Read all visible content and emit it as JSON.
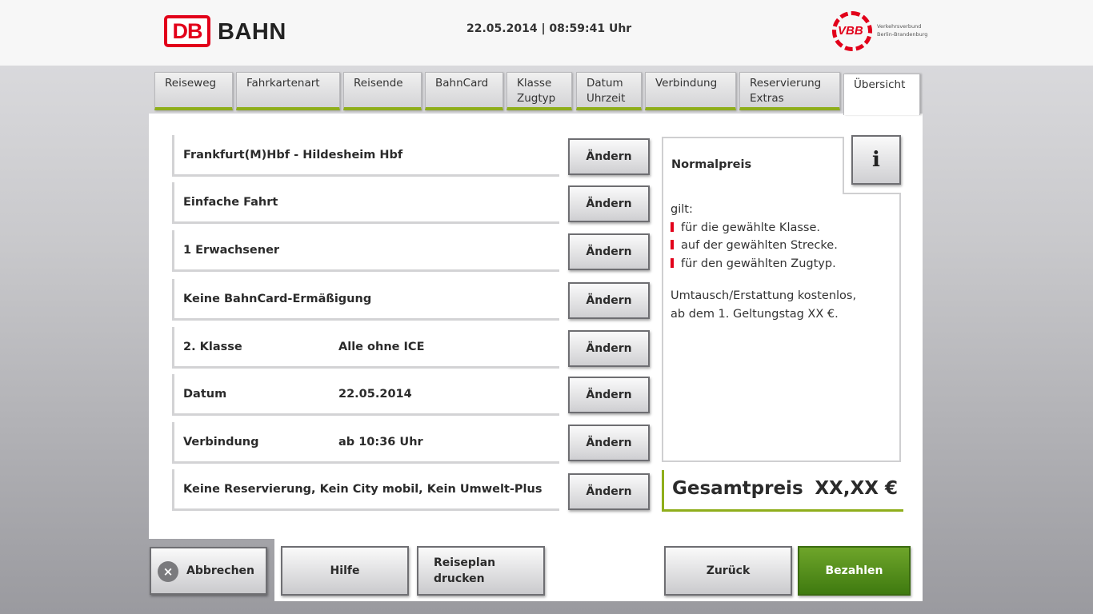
{
  "header": {
    "db_logo": "DB",
    "brand": "BAHN",
    "datetime": "22.05.2014 | 08:59:41 Uhr",
    "vbb_logo": "VBB",
    "vbb_line1": "Verkehrsverbund",
    "vbb_line2": "Berlin-Brandenburg"
  },
  "tabs": [
    {
      "line1": "Reiseweg",
      "line2": ""
    },
    {
      "line1": "Fahrkartenart",
      "line2": ""
    },
    {
      "line1": "Reisende",
      "line2": ""
    },
    {
      "line1": "BahnCard",
      "line2": ""
    },
    {
      "line1": "Klasse",
      "line2": "Zugtyp"
    },
    {
      "line1": "Datum",
      "line2": "Uhrzeit"
    },
    {
      "line1": "Verbindung",
      "line2": ""
    },
    {
      "line1": "Reservierung",
      "line2": "Extras"
    },
    {
      "line1": "Übersicht",
      "line2": ""
    }
  ],
  "rows": [
    {
      "label": "Frankfurt(M)Hbf - Hildesheim Hbf",
      "value": ""
    },
    {
      "label": "Einfache Fahrt",
      "value": ""
    },
    {
      "label": "1 Erwachsener",
      "value": ""
    },
    {
      "label": "Keine BahnCard-Ermäßigung",
      "value": ""
    },
    {
      "label": "2. Klasse",
      "value": "Alle ohne ICE"
    },
    {
      "label": "Datum",
      "value": "22.05.2014"
    },
    {
      "label": "Verbindung",
      "value": "ab 10:36 Uhr"
    },
    {
      "label": "Keine Reservierung, Kein City mobil, Kein Umwelt-Plus",
      "value": ""
    }
  ],
  "change_label": "Ändern",
  "info": {
    "title": "Normalpreis",
    "button": "i",
    "intro": "gilt:",
    "bullets": [
      "für die gewählte Klasse.",
      "auf der gewählten Strecke.",
      "für den gewählten Zugtyp."
    ],
    "note1": "Umtausch/Erstattung kostenlos,",
    "note2": "ab dem 1. Geltungstag XX €."
  },
  "total": {
    "label": "Gesamtpreis",
    "value": "XX,XX €"
  },
  "buttons": {
    "cancel": "Abbrechen",
    "cancel_icon": "×",
    "help": "Hilfe",
    "print_line1": "Reiseplan",
    "print_line2": "drucken",
    "back": "Zurück",
    "pay": "Bezahlen"
  },
  "colors": {
    "db_red": "#e2001a",
    "accent_green": "#8fae1b",
    "pay_green": "#4f8a18"
  }
}
